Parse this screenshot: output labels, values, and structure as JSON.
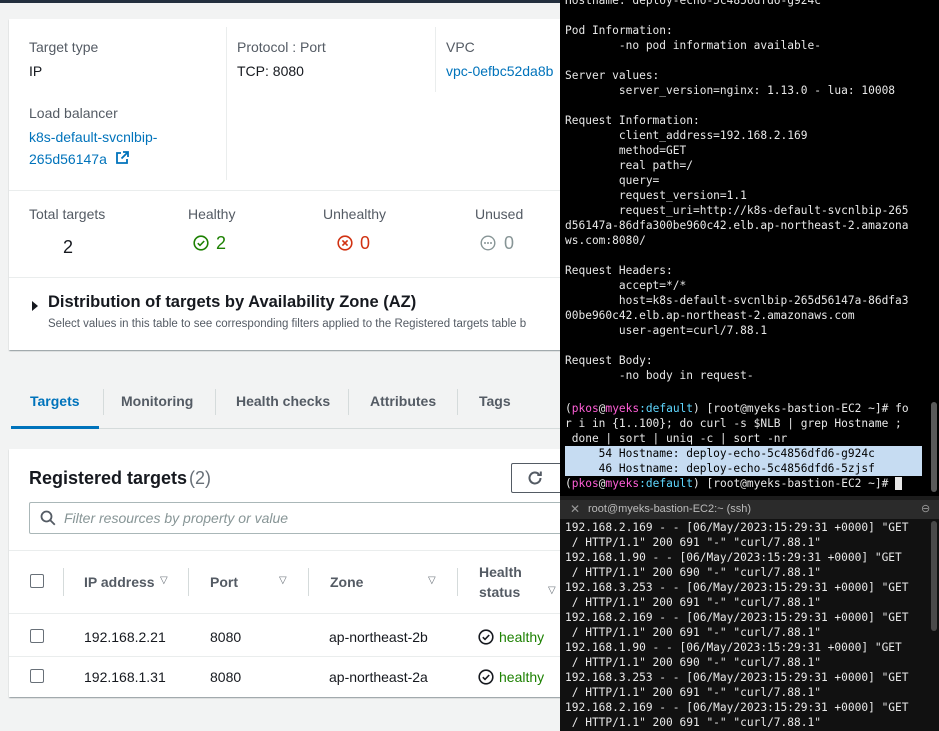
{
  "overview": {
    "target_type_label": "Target type",
    "target_type_value": "IP",
    "protocol_label": "Protocol : Port",
    "protocol_value": "TCP: 8080",
    "vpc_label": "VPC",
    "vpc_value": "vpc-0efbc52da8b",
    "lb_label": "Load balancer",
    "lb_value_line1": "k8s-default-svcnlbip-",
    "lb_value_line2": "265d56147a",
    "total_label": "Total targets",
    "total_value": "2",
    "healthy_label": "Healthy",
    "healthy_value": "2",
    "unhealthy_label": "Unhealthy",
    "unhealthy_value": "0",
    "unused_label": "Unused",
    "unused_value": "0",
    "az_title": "Distribution of targets by Availability Zone (AZ)",
    "az_subtitle": "Select values in this table to see corresponding filters applied to the Registered targets table b"
  },
  "tabs": [
    "Targets",
    "Monitoring",
    "Health checks",
    "Attributes",
    "Tags"
  ],
  "registered": {
    "title": "Registered targets",
    "count": "(2)",
    "filter_placeholder": "Filter resources by property or value",
    "columns": {
      "ip": "IP address",
      "port": "Port",
      "zone": "Zone",
      "health_line1": "Health",
      "health_line2": "status"
    },
    "rows": [
      {
        "ip": "192.168.2.21",
        "port": "8080",
        "zone": "ap-northeast-2b",
        "health": "healthy"
      },
      {
        "ip": "192.168.1.31",
        "port": "8080",
        "zone": "ap-northeast-2a",
        "health": "healthy"
      }
    ]
  },
  "terminal1": {
    "lines": [
      "Hostname: deploy-echo-5c4856dfd6-g924c",
      "",
      "Pod Information:",
      "        -no pod information available-",
      "",
      "Server values:",
      "        server_version=nginx: 1.13.0 - lua: 10008",
      "",
      "Request Information:",
      "        client_address=192.168.2.169",
      "        method=GET",
      "        real path=/",
      "        query=",
      "        request_version=1.1",
      "        request_uri=http://k8s-default-svcnlbip-265",
      "d56147a-86dfa300be960c42.elb.ap-northeast-2.amazona",
      "ws.com:8080/",
      "",
      "Request Headers:",
      "        accept=*/*",
      "        host=k8s-default-svcnlbip-265d56147a-86dfa3",
      "00be960c42.elb.ap-northeast-2.amazonaws.com",
      "        user-agent=curl/7.88.1",
      "",
      "Request Body:",
      "        -no body in request-",
      ""
    ],
    "prompt_user": "pkos",
    "prompt_at": "@",
    "prompt_host": "myeks",
    "prompt_ctx": ":default",
    "prompt_rest": ") [root@myeks-bastion-EC2 ~]# ",
    "command_l1": "fo",
    "command_l2": "r i in {1..100}; do curl -s $NLB | grep Hostname ;",
    "command_l3": " done | sort | uniq -c | sort -nr",
    "result_1": "     54 Hostname: deploy-echo-5c4856dfd6-g924c",
    "result_2": "     46 Hostname: deploy-echo-5c4856dfd6-5zjsf"
  },
  "terminal_tab_title": "root@myeks-bastion-EC2:~ (ssh)",
  "terminal2": {
    "lines": [
      "192.168.2.169 - - [06/May/2023:15:29:31 +0000] \"GET",
      " / HTTP/1.1\" 200 691 \"-\" \"curl/7.88.1\"",
      "192.168.1.90 - - [06/May/2023:15:29:31 +0000] \"GET",
      " / HTTP/1.1\" 200 690 \"-\" \"curl/7.88.1\"",
      "192.168.3.253 - - [06/May/2023:15:29:31 +0000] \"GET",
      " / HTTP/1.1\" 200 691 \"-\" \"curl/7.88.1\"",
      "192.168.2.169 - - [06/May/2023:15:29:31 +0000] \"GET",
      " / HTTP/1.1\" 200 691 \"-\" \"curl/7.88.1\"",
      "192.168.1.90 - - [06/May/2023:15:29:31 +0000] \"GET",
      " / HTTP/1.1\" 200 690 \"-\" \"curl/7.88.1\"",
      "192.168.3.253 - - [06/May/2023:15:29:31 +0000] \"GET",
      " / HTTP/1.1\" 200 691 \"-\" \"curl/7.88.1\"",
      "192.168.2.169 - - [06/May/2023:15:29:31 +0000] \"GET",
      " / HTTP/1.1\" 200 691 \"-\" \"curl/7.88.1\""
    ]
  },
  "colors": {
    "link": "#0073bb",
    "healthy": "#1d8102",
    "unhealthy": "#d13212",
    "active_tab": "#0073bb",
    "terminal_bg": "#000000",
    "prompt_pink": "#ff5fd7",
    "prompt_cyan": "#5fd7ff",
    "selection": "#c6dcf2"
  }
}
